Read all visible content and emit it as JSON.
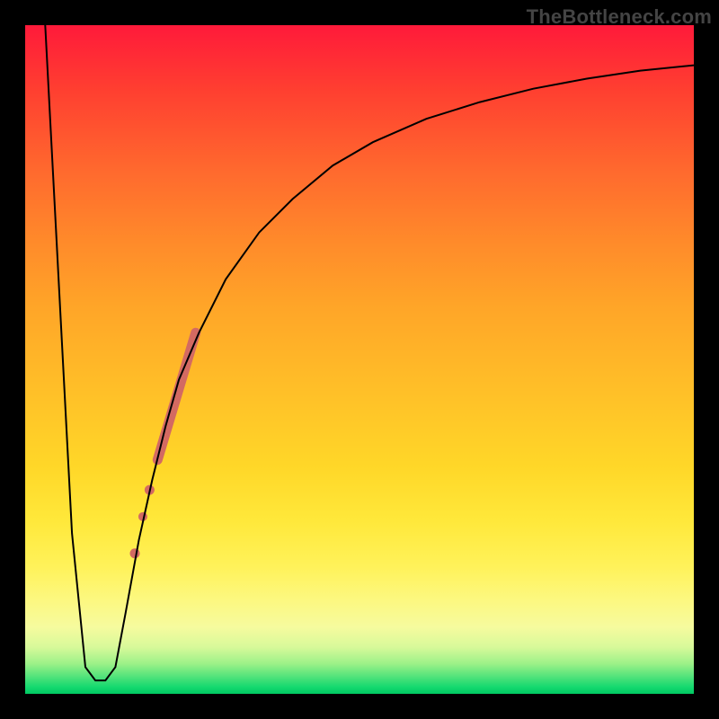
{
  "watermark": "TheBottleneck.com",
  "chart_data": {
    "type": "line",
    "title": "",
    "xlabel": "",
    "ylabel": "",
    "xlim": [
      0,
      100
    ],
    "ylim": [
      0,
      100
    ],
    "grid": false,
    "series": [
      {
        "name": "bottleneck-curve",
        "x": [
          3,
          7,
          9,
          10.5,
          12,
          13.5,
          15,
          17,
          19,
          21,
          23,
          26,
          30,
          35,
          40,
          46,
          52,
          60,
          68,
          76,
          84,
          92,
          100
        ],
        "y": [
          100,
          24,
          4,
          2,
          2,
          4,
          12,
          23,
          32,
          40,
          47,
          54,
          62,
          69,
          74,
          79,
          82.5,
          86,
          88.5,
          90.5,
          92,
          93.2,
          94
        ],
        "stroke": "#000000",
        "stroke_width": 2
      }
    ],
    "markers": [
      {
        "name": "highlight-segment",
        "type": "segment",
        "x1": 19.8,
        "y1": 35,
        "x2": 25.5,
        "y2": 54,
        "stroke": "#d36a62",
        "stroke_width": 11,
        "cap": "round"
      },
      {
        "name": "dot-1",
        "type": "circle",
        "x": 18.6,
        "y": 30.5,
        "r": 5.5,
        "fill": "#d36a62"
      },
      {
        "name": "dot-2",
        "type": "circle",
        "x": 17.6,
        "y": 26.5,
        "r": 5.0,
        "fill": "#d36a62"
      },
      {
        "name": "dot-3",
        "type": "circle",
        "x": 16.4,
        "y": 21.0,
        "r": 5.5,
        "fill": "#d36a62"
      }
    ],
    "colors": {
      "gradient_top": "#ff1a3a",
      "gradient_bottom": "#00c862",
      "curve": "#000000",
      "marker": "#d36a62",
      "frame": "#000000"
    }
  }
}
